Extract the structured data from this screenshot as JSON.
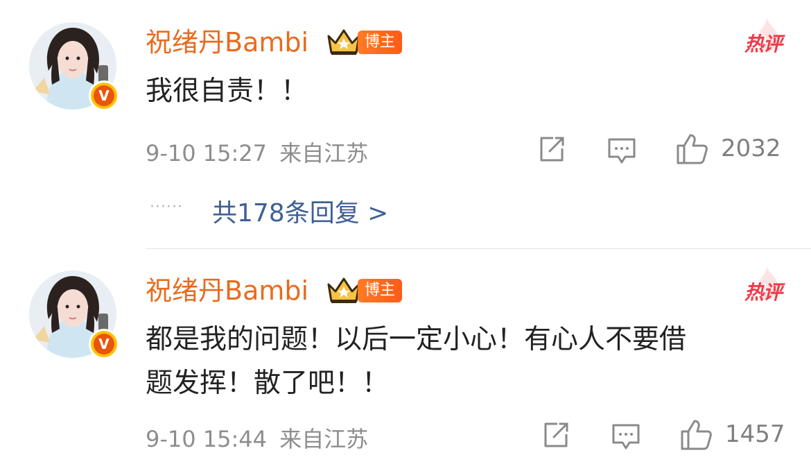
{
  "comments": [
    {
      "username": "祝绪丹Bambi",
      "badge_label": "博主",
      "hot_label": "热评",
      "text_lines": [
        "我很自责！！"
      ],
      "date": "9-10",
      "time": "15:27",
      "location": "来自江苏",
      "likes": "2032",
      "replies_label": "共178条回复 >"
    },
    {
      "username": "祝绪丹Bambi",
      "badge_label": "博主",
      "hot_label": "热评",
      "text_lines": [
        "都是我的问题！以后一定小心！有心人不要借",
        "题发挥！散了吧！！"
      ],
      "date": "9-10",
      "time": "15:44",
      "location": "来自江苏",
      "likes": "1457"
    }
  ],
  "colors": {
    "username": "#e86b1e",
    "hot": "#ef3b47",
    "reply_link": "#3f5f96",
    "meta": "#8d8d8d"
  },
  "icons": [
    "verified-v-icon",
    "crown-icon",
    "share-icon",
    "comment-icon",
    "like-icon"
  ]
}
